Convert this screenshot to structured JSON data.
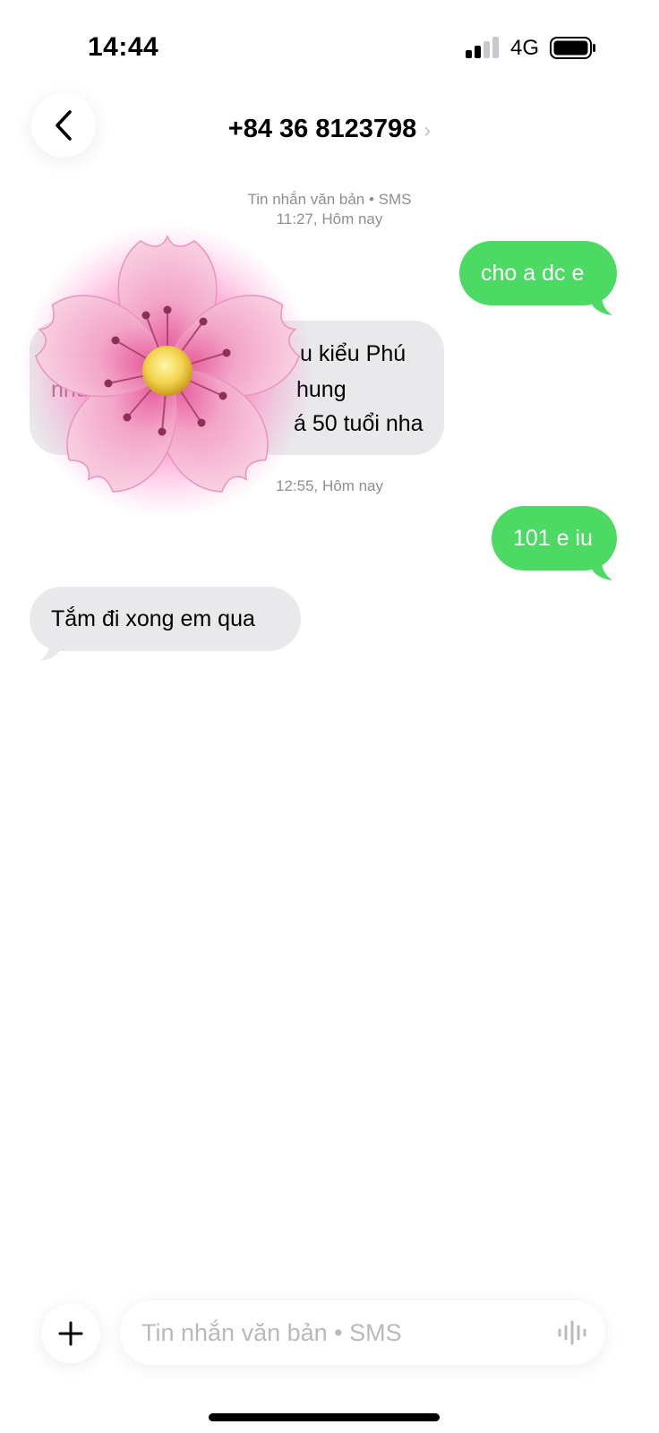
{
  "status_bar": {
    "time": "14:44",
    "network": "4G"
  },
  "header": {
    "contact": "+84 36 8123798",
    "chevron": "›"
  },
  "thread": {
    "meta1": {
      "line1": "Tin nhắn văn bản • SMS",
      "line2": "11:27, Hôm nay"
    },
    "msg1": "cho a dc e",
    "msg2": {
      "line1": "u kiểu Phú",
      "line2_start": "như",
      "line2_end": "hung",
      "line3": "á 50 tuổi nha"
    },
    "meta2": "12:55, Hôm nay",
    "msg3": "101 e iu",
    "msg4": "Tắm đi xong em qua"
  },
  "composer": {
    "placeholder": "Tin nhắn văn bản • SMS"
  },
  "icons": {
    "back": "chevron-left-icon",
    "plus": "plus-icon",
    "voice": "waveform-icon",
    "sticker": "cherry-blossom-sticker"
  },
  "colors": {
    "outgoing": "#4cd964",
    "incoming": "#e9e9eb",
    "meta": "#8e8e93"
  }
}
